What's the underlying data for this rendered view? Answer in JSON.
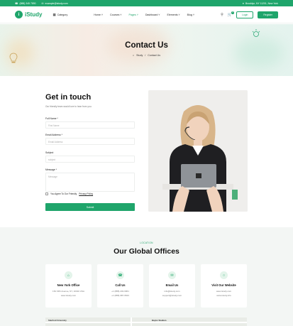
{
  "topbar": {
    "phone": "(888) 345 7890",
    "email": "example@istudy.com",
    "address": "Brooklyn, NY 11201, New York"
  },
  "brand": {
    "name": "iStudy",
    "accent": "#1fa56b"
  },
  "nav": {
    "category_label": "Category",
    "items": [
      {
        "label": "Home"
      },
      {
        "label": "Courses"
      },
      {
        "label": "Pages"
      },
      {
        "label": "Dashboard"
      },
      {
        "label": "Elements"
      },
      {
        "label": "Blog"
      }
    ],
    "cart_count": "0",
    "login_label": "Login",
    "register_label": "Register"
  },
  "hero": {
    "title": "Contact Us",
    "breadcrumb_home": "Study",
    "breadcrumb_sep": "/",
    "breadcrumb_current": "Contact Us"
  },
  "form": {
    "title": "Get in touch",
    "subtitle": "Our friendly team would love to hear from you.",
    "full_name_label": "Full Name *",
    "full_name_placeholder": "First Name",
    "email_label": "Email Address *",
    "email_placeholder": "Email Address",
    "subject_label": "Subject",
    "subject_placeholder": "subject",
    "message_label": "Message *",
    "message_placeholder": "Message",
    "agree_text": "You Agree To Our Friendly ",
    "agree_link": "Privacy Policy",
    "submit_label": "Submit"
  },
  "offices": {
    "eyebrow": "LOCATION",
    "title": "Our Global Offices",
    "cards": [
      {
        "icon": "home-icon",
        "title": "New York Office",
        "line1": "152 Fifth Avenue, NY, 10010 USA",
        "line2": "www.istudy.com"
      },
      {
        "icon": "phone-icon",
        "title": "Call Us",
        "line1": "+1 (888) 234-6061",
        "line2": "+1 (888) 987-6543"
      },
      {
        "icon": "mail-icon",
        "title": "Email Us",
        "line1": "info@istudy.com",
        "line2": "support@istudy.com"
      },
      {
        "icon": "globe-icon",
        "title": "Visit Our Website",
        "line1": "www.istudy.com",
        "line2": "www.istudy.info"
      }
    ]
  },
  "map": {
    "label1": "Stanford University",
    "label2": "Baylor Stadium"
  }
}
